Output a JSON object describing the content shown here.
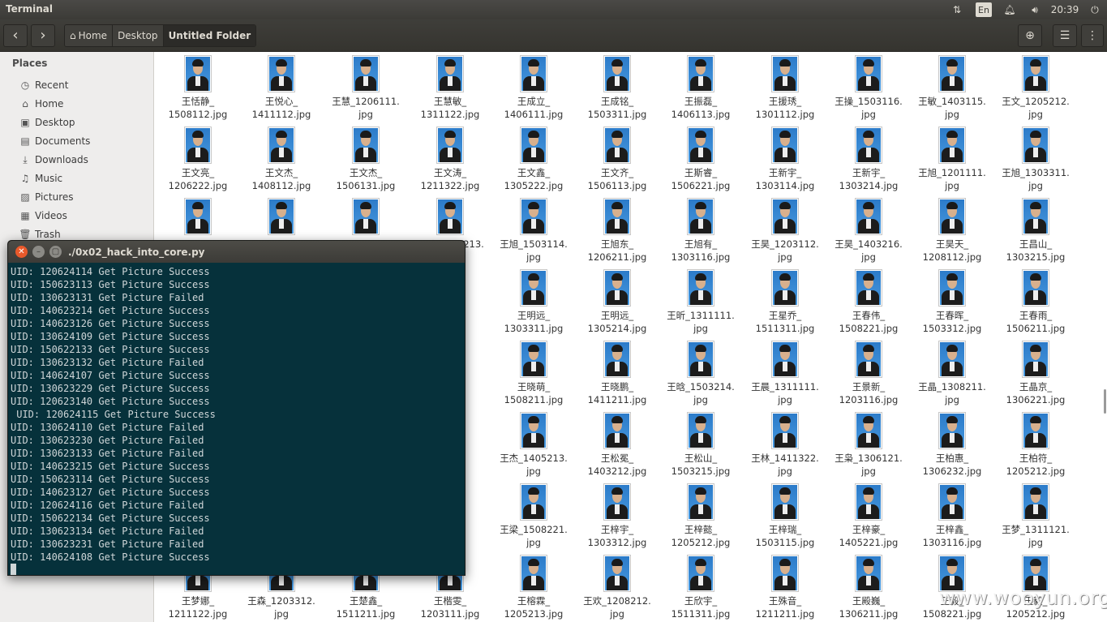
{
  "topbar": {
    "app_title": "Terminal",
    "keyboard": "En",
    "clock": "20:39"
  },
  "toolbar": {
    "breadcrumbs": [
      "Home",
      "Desktop",
      "Untitled Folder"
    ]
  },
  "sidebar": {
    "heading": "Places",
    "items": [
      "Recent",
      "Home",
      "Desktop",
      "Documents",
      "Downloads",
      "Music",
      "Pictures",
      "Videos",
      "Trash"
    ]
  },
  "files": [
    [
      "王恬静_",
      "1508112.jpg"
    ],
    [
      "王悦心_",
      "1411112.jpg"
    ],
    [
      "王慧_1206111.",
      "jpg"
    ],
    [
      "王慧敏_",
      "1311122.jpg"
    ],
    [
      "王成立_",
      "1406111.jpg"
    ],
    [
      "王成铭_",
      "1503311.jpg"
    ],
    [
      "王振磊_",
      "1406113.jpg"
    ],
    [
      "王援琇_",
      "1301112.jpg"
    ],
    [
      "王操_1503116.",
      "jpg"
    ],
    [
      "王敏_1403115.",
      "jpg"
    ],
    [
      "王文_1205212.",
      "jpg"
    ],
    [
      "王文亮_",
      "1206222.jpg"
    ],
    [
      "王文杰_",
      "1408112.jpg"
    ],
    [
      "王文杰_",
      "1506131.jpg"
    ],
    [
      "王文涛_",
      "1211322.jpg"
    ],
    [
      "王文鑫_",
      "1305222.jpg"
    ],
    [
      "王文齐_",
      "1506113.jpg"
    ],
    [
      "王斯睿_",
      "1506221.jpg"
    ],
    [
      "王新宇_",
      "1303114.jpg"
    ],
    [
      "王新宇_",
      "1303214.jpg"
    ],
    [
      "王旭_1201111.",
      "jpg"
    ],
    [
      "王旭_1303311.",
      "jpg"
    ],
    [
      "",
      "1..."
    ],
    [
      "",
      "1..."
    ],
    [
      "",
      "1..."
    ],
    [
      "王旸_1402213.",
      "jpg"
    ],
    [
      "王旭_1503114.",
      "jpg"
    ],
    [
      "王旭东_",
      "1206211.jpg"
    ],
    [
      "王旭有_",
      "1303116.jpg"
    ],
    [
      "王昊_1203112.",
      "jpg"
    ],
    [
      "王昊_1403216.",
      "jpg"
    ],
    [
      "王昊天_",
      "1208112.jpg"
    ],
    [
      "王昌山_",
      "1303215.jpg"
    ],
    [
      "",
      ""
    ],
    [
      "",
      ""
    ],
    [
      "",
      ""
    ],
    [
      "",
      "jpg"
    ],
    [
      "王明远_",
      "1303311.jpg"
    ],
    [
      "王明远_",
      "1305214.jpg"
    ],
    [
      "王昕_1311111.",
      "jpg"
    ],
    [
      "王星乔_",
      "1511311.jpg"
    ],
    [
      "王春伟_",
      "1508221.jpg"
    ],
    [
      "王春晖_",
      "1503312.jpg"
    ],
    [
      "王春雨_",
      "1506211.jpg"
    ],
    [
      "",
      ""
    ],
    [
      "",
      ""
    ],
    [
      "",
      ""
    ],
    [
      "",
      "jpg"
    ],
    [
      "王晓萌_",
      "1508211.jpg"
    ],
    [
      "王晓鹏_",
      "1411211.jpg"
    ],
    [
      "王晗_1503214.",
      "jpg"
    ],
    [
      "王晨_1311111.",
      "jpg"
    ],
    [
      "王景新_",
      "1203116.jpg"
    ],
    [
      "王晶_1308211.",
      "jpg"
    ],
    [
      "王晶京_",
      "1306221.jpg"
    ],
    [
      "",
      ""
    ],
    [
      "",
      ""
    ],
    [
      "",
      ""
    ],
    [
      "",
      ""
    ],
    [
      "王杰_1405213.",
      "jpg"
    ],
    [
      "王松冕_",
      "1403212.jpg"
    ],
    [
      "王松山_",
      "1503215.jpg"
    ],
    [
      "王林_1411322.",
      "jpg"
    ],
    [
      "王枭_1306121.",
      "jpg"
    ],
    [
      "王柏惠_",
      "1306232.jpg"
    ],
    [
      "王柏符_",
      "1205212.jpg"
    ],
    [
      "",
      ""
    ],
    [
      "",
      ""
    ],
    [
      "",
      ""
    ],
    [
      "",
      ""
    ],
    [
      "王梁_1508221.",
      "jpg"
    ],
    [
      "王梓宇_",
      "1303312.jpg"
    ],
    [
      "王梓懿_",
      "1205212.jpg"
    ],
    [
      "王梓瑞_",
      "1503115.jpg"
    ],
    [
      "王梓豪_",
      "1405221.jpg"
    ],
    [
      "王梓鑫_",
      "1303116.jpg"
    ],
    [
      "王梦_1311121.",
      "jpg"
    ],
    [
      "王梦娜_",
      "1211122.jpg"
    ],
    [
      "王森_1203312.",
      "jpg"
    ],
    [
      "王楚鑫_",
      "1511211.jpg"
    ],
    [
      "王楷雯_",
      "1203111.jpg"
    ],
    [
      "王榕霖_",
      "1205213.jpg"
    ],
    [
      "王欢_1208212.",
      "jpg"
    ],
    [
      "王欣宇_",
      "1511311.jpg"
    ],
    [
      "王殊音_",
      "1211211.jpg"
    ],
    [
      "王殿巍_",
      "1306211.jpg"
    ],
    [
      "王毅_",
      "1508221.jpg"
    ],
    [
      "王毅_",
      "1205212.jpg"
    ]
  ],
  "terminal": {
    "title": "./0x02_hack_into_core.py",
    "lines": [
      "UID: 120624114 Get Picture Success",
      "UID: 150623113 Get Picture Success",
      "UID: 130623131 Get Picture Failed",
      "UID: 140623214 Get Picture Success",
      "UID: 140623126 Get Picture Success",
      "UID: 130624109 Get Picture Success",
      "UID: 150622133 Get Picture Success",
      "UID: 130623132 Get Picture Failed",
      "UID: 140624107 Get Picture Success",
      "UID: 130623229 Get Picture Success",
      "UID: 120623140 Get Picture Success",
      " UID: 120624115 Get Picture Success",
      "UID: 130624110 Get Picture Failed",
      "UID: 130623230 Get Picture Failed",
      "UID: 130623133 Get Picture Failed",
      "UID: 140623215 Get Picture Success",
      "UID: 150623114 Get Picture Success",
      "UID: 140623127 Get Picture Success",
      "UID: 120624116 Get Picture Failed",
      "UID: 150622134 Get Picture Success",
      "UID: 130623134 Get Picture Failed",
      "UID: 130623231 Get Picture Failed",
      "UID: 140624108 Get Picture Success"
    ]
  },
  "watermark": "www.wooyun.org"
}
